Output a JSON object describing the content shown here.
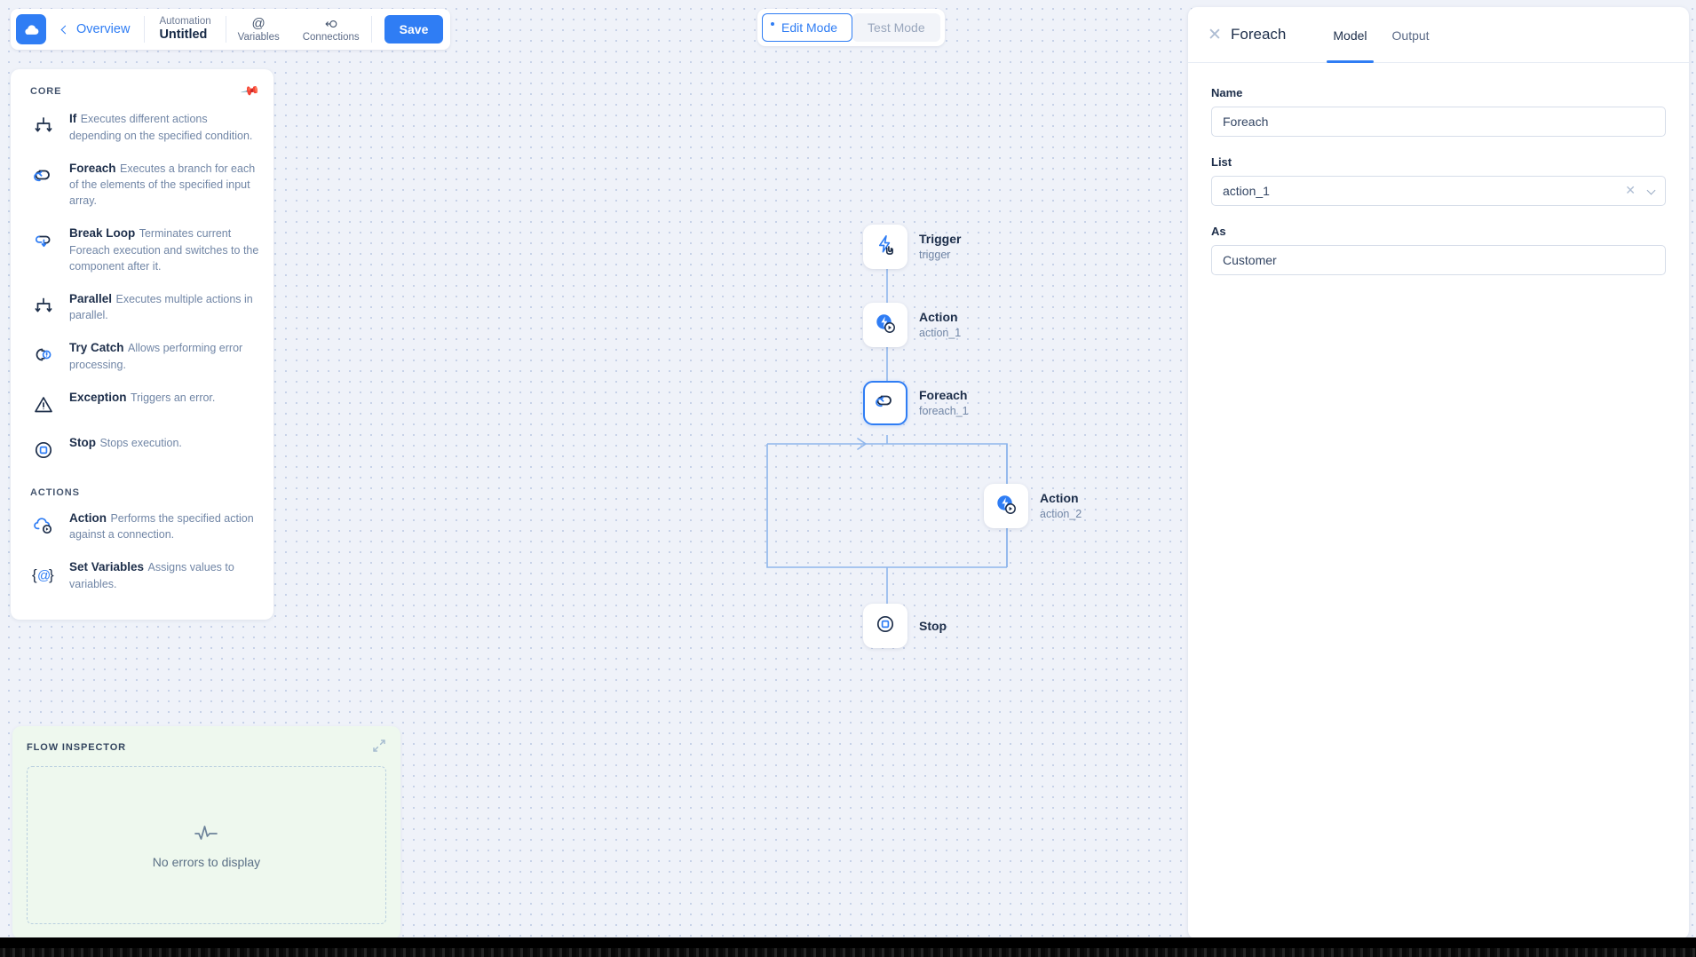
{
  "header": {
    "logo_icon": "cloud-icon",
    "back_label": "Overview",
    "breadcrumb_sub": "Automation",
    "breadcrumb_title": "Untitled",
    "variables_icon": "at-icon",
    "variables_label": "Variables",
    "connections_icon": "connection-icon",
    "connections_label": "Connections",
    "save_label": "Save",
    "accent_color": "#2f7df4"
  },
  "mode_toggle": {
    "edit_label": "Edit Mode",
    "test_label": "Test Mode",
    "active": "Edit Mode"
  },
  "palette": {
    "pin_icon": "pin-icon",
    "sections": [
      {
        "title": "CORE",
        "items": [
          {
            "icon": "if-branch-icon",
            "name": "If",
            "desc": "Executes different actions depending on the specified condition."
          },
          {
            "icon": "loop-icon",
            "name": "Foreach",
            "desc": "Executes a branch for each of the elements of the specified input array."
          },
          {
            "icon": "break-loop-icon",
            "name": "Break Loop",
            "desc": "Terminates current Foreach execution and switches to the component after it."
          },
          {
            "icon": "parallel-icon",
            "name": "Parallel",
            "desc": "Executes multiple actions in parallel."
          },
          {
            "icon": "try-catch-icon",
            "name": "Try Catch",
            "desc": "Allows performing error processing."
          },
          {
            "icon": "warning-triangle-icon",
            "name": "Exception",
            "desc": "Triggers an error."
          },
          {
            "icon": "stop-icon",
            "name": "Stop",
            "desc": "Stops execution."
          }
        ]
      },
      {
        "title": "ACTIONS",
        "items": [
          {
            "icon": "cloud-play-icon",
            "name": "Action",
            "desc": "Performs the specified action against a connection."
          },
          {
            "icon": "set-variables-icon",
            "name": "Set Variables",
            "desc": "Assigns values to variables."
          }
        ]
      }
    ]
  },
  "inspector": {
    "title": "FLOW INSPECTOR",
    "expand_icon": "expand-collapse-icon",
    "empty_icon": "pulse-icon",
    "empty_text": "No errors to display"
  },
  "graph": {
    "nodes": [
      {
        "icon": "trigger-bolt-icon",
        "title": "Trigger",
        "sub": "trigger",
        "selected": false
      },
      {
        "icon": "action-bolt-icon",
        "title": "Action",
        "sub": "action_1",
        "selected": false
      },
      {
        "icon": "loop-icon",
        "title": "Foreach",
        "sub": "foreach_1",
        "selected": true
      },
      {
        "icon": "action-bolt-icon",
        "title": "Action",
        "sub": "action_2",
        "selected": false
      },
      {
        "icon": "stop-icon",
        "title": "Stop",
        "sub": "",
        "selected": false
      }
    ],
    "edge_color": "#8fb6ec"
  },
  "panel": {
    "close_icon": "close-icon",
    "title": "Foreach",
    "tabs": [
      {
        "label": "Model",
        "active": true
      },
      {
        "label": "Output",
        "active": false
      }
    ],
    "fields": {
      "name_label": "Name",
      "name_value": "Foreach",
      "list_label": "List",
      "list_value": "action_1",
      "list_clear_icon": "clear-icon",
      "list_caret_icon": "chevron-down-icon",
      "as_label": "As",
      "as_value": "Customer"
    }
  }
}
